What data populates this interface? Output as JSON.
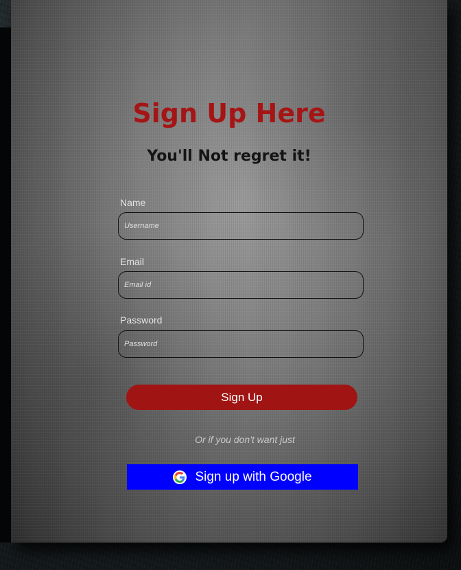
{
  "header": {
    "title": "Sign Up Here",
    "subtitle": "You'll Not regret it!"
  },
  "form": {
    "name": {
      "label": "Name",
      "placeholder": "Username",
      "value": ""
    },
    "email": {
      "label": "Email",
      "placeholder": "Email id",
      "value": ""
    },
    "password": {
      "label": "Password",
      "placeholder": "Password",
      "value": ""
    },
    "submit_label": "Sign Up"
  },
  "alt": {
    "or_text": "Or if you don't want just",
    "google_label": "Sign up with Google",
    "google_icon": "google-g-icon"
  },
  "colors": {
    "title": "#a51515",
    "signup_button": "#a11414",
    "google_button": "#0000ff"
  }
}
